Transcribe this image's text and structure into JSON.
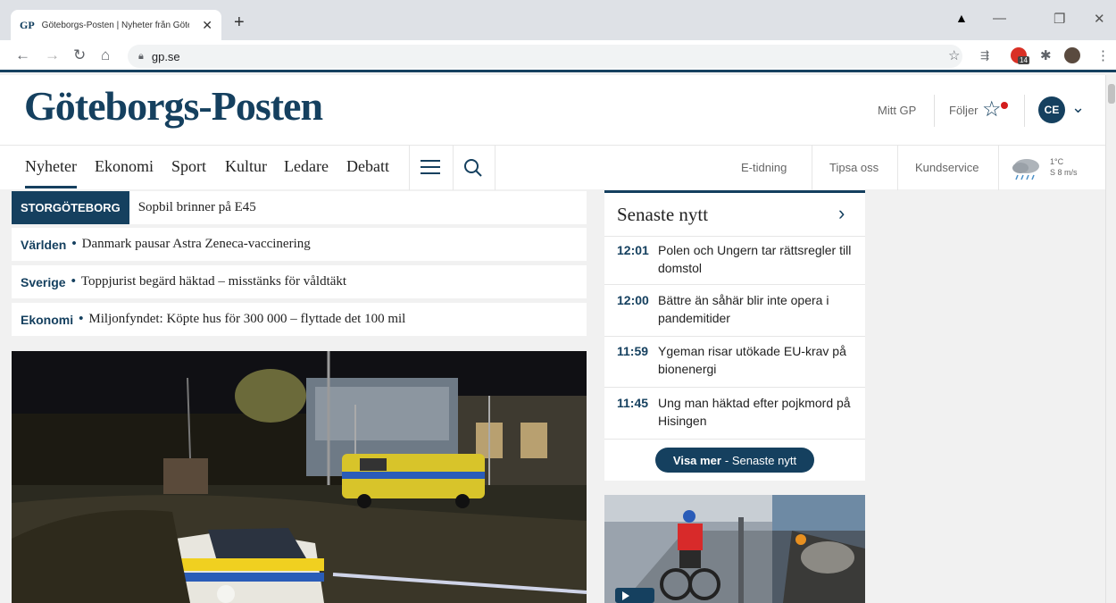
{
  "browser": {
    "tab_favicon": "GP",
    "tab_title": "Göteborgs-Posten | Nyheter från Göteb...",
    "new_tab": "+",
    "url": "gp.se",
    "ext_badge": "14",
    "icons": [
      "back-icon",
      "forward-icon",
      "reload-icon",
      "home-icon",
      "lock-icon",
      "star-icon",
      "extension-icon",
      "puzzle-icon",
      "profile-icon",
      "menu-icon"
    ]
  },
  "header": {
    "logo": "Göteborgs-Posten",
    "mitt_gp": "Mitt GP",
    "foljer": "Följer",
    "avatar_initials": "CE"
  },
  "nav": {
    "items": [
      "Nyheter",
      "Ekonomi",
      "Sport",
      "Kultur",
      "Ledare",
      "Debatt"
    ],
    "active": "Nyheter",
    "right": [
      "E-tidning",
      "Tipsa oss",
      "Kundservice"
    ],
    "weather_temp": "1°C",
    "weather_wind": "S 8 m/s"
  },
  "breaking": [
    {
      "tag": "STORGÖTEBORG",
      "text": "Sopbil brinner på E45"
    },
    {
      "category": "Världen",
      "text": "Danmark pausar Astra Zeneca-vaccinering"
    },
    {
      "category": "Sverige",
      "text": "Toppjurist begärd häktad – misstänks för våldtäkt"
    },
    {
      "category": "Ekonomi",
      "text": "Miljonfyndet: Köpte hus för 300 000 – flyttade det 100 mil"
    }
  ],
  "senaste": {
    "title": "Senaste nytt",
    "items": [
      {
        "time": "12:01",
        "text": "Polen och Ungern tar rättsregler till domstol"
      },
      {
        "time": "12:00",
        "text": "Bättre än såhär blir inte opera i pandemitider"
      },
      {
        "time": "11:59",
        "text": "Ygeman risar utökade EU-krav på bionenergi"
      },
      {
        "time": "11:45",
        "text": "Ung man häktad efter pojkmord på Hisingen"
      }
    ],
    "visa_mer_bold": "Visa mer",
    "visa_mer_rest": "- Senaste nytt"
  },
  "colors": {
    "brand": "#15405f",
    "alert_dot": "#d31c1c"
  }
}
